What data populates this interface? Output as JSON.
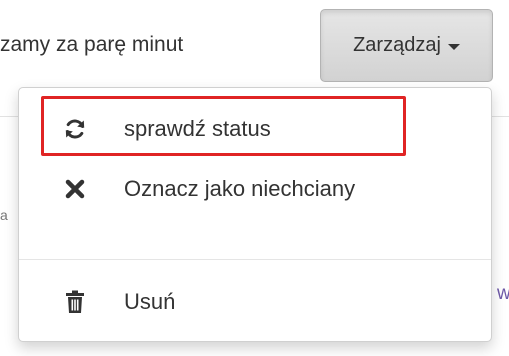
{
  "background": {
    "message_fragment": "zamy za parę minut",
    "left_fragment": "a",
    "right_fragment": "w"
  },
  "manage_button": {
    "label": "Zarządzaj",
    "caret_icon": "caret-down-icon"
  },
  "dropdown": {
    "items": [
      {
        "label": "sprawdź status",
        "icon": "refresh-icon",
        "highlighted": true
      },
      {
        "label": "Oznacz jako niechciany",
        "icon": "close-icon",
        "highlighted": false
      },
      {
        "label": "Usuń",
        "icon": "trash-icon",
        "highlighted": false
      }
    ],
    "highlight_color": "#e02424"
  }
}
